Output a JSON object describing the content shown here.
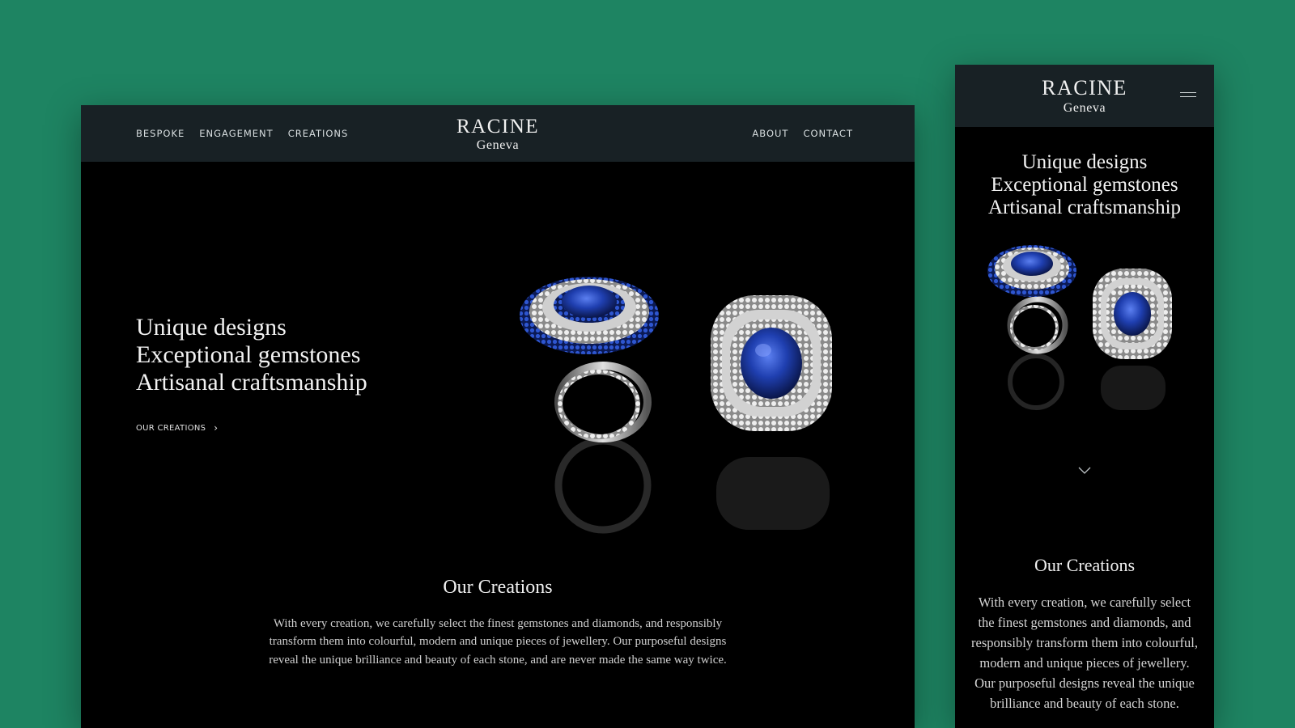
{
  "brand": {
    "name": "RACINE",
    "city": "Geneva"
  },
  "desktop": {
    "nav_left": [
      "BESPOKE",
      "ENGAGEMENT",
      "CREATIONS"
    ],
    "nav_right": [
      "ABOUT",
      "CONTACT"
    ],
    "hero": {
      "lines": [
        "Unique designs",
        "Exceptional gemstones",
        "Artisanal craftsmanship"
      ],
      "cta_label": "OUR CREATIONS",
      "cta_icon": "chevron-right-icon",
      "image": "sapphire-diamond-rings"
    },
    "section": {
      "title": "Our Creations",
      "body": "With every creation, we carefully select the finest gemstones and diamonds, and responsibly transform them into colourful, modern and unique pieces of jewellery. Our purposeful designs reveal the unique brilliance and beauty of each stone, and are never made the same way twice."
    }
  },
  "mobile": {
    "menu_icon": "hamburger-menu-icon",
    "hero": {
      "lines": [
        "Unique designs",
        "Exceptional gemstones",
        "Artisanal craftsmanship"
      ],
      "image": "sapphire-diamond-rings",
      "scroll_icon": "chevron-down-icon"
    },
    "section": {
      "title": "Our Creations",
      "body": "With every creation, we carefully select the finest gemstones and diamonds, and responsibly transform them into colourful, modern and unique pieces of jewellery. Our purposeful designs reveal the unique brilliance and beauty of each stone."
    }
  },
  "colors": {
    "page_background": "#1e8462",
    "header_background": "#182125",
    "hero_background": "#000000",
    "sapphire": "#1a3fb0",
    "text": "#f1f1f1"
  }
}
